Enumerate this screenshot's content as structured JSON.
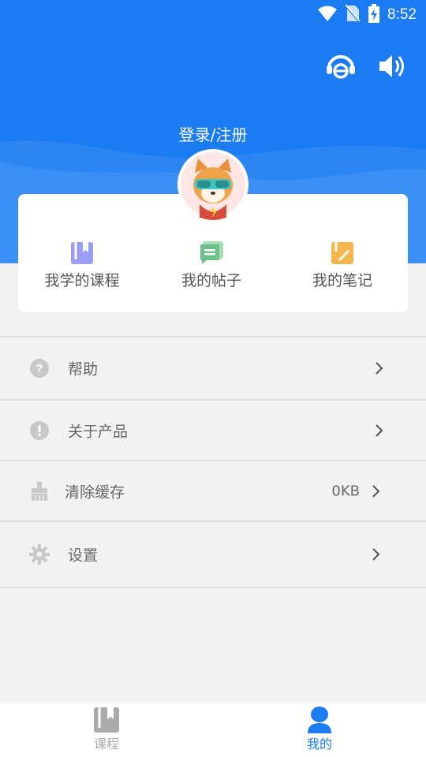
{
  "status_bar": {
    "time": "8:52",
    "icons": [
      "wifi-icon",
      "no-sim-icon",
      "battery-charging-icon"
    ]
  },
  "header": {
    "login_label": "登录/注册",
    "actions": [
      "customer-service-icon",
      "volume-icon"
    ]
  },
  "shortcuts": [
    {
      "label": "我学的课程",
      "icon": "book-icon",
      "color": "#9b9ef7"
    },
    {
      "label": "我的帖子",
      "icon": "message-icon",
      "color": "#6cc08a"
    },
    {
      "label": "我的笔记",
      "icon": "note-icon",
      "color": "#f7b64d"
    }
  ],
  "menu": [
    {
      "label": "帮助",
      "icon": "help-icon",
      "value": ""
    },
    {
      "label": "关于产品",
      "icon": "info-icon",
      "value": ""
    },
    {
      "label": "清除缓存",
      "icon": "broom-icon",
      "value": "0KB"
    },
    {
      "label": "设置",
      "icon": "gear-icon",
      "value": ""
    }
  ],
  "tabbar": {
    "tabs": [
      {
        "label": "课程",
        "icon": "course-tab-icon",
        "active": false
      },
      {
        "label": "我的",
        "icon": "profile-tab-icon",
        "active": true
      }
    ]
  },
  "colors": {
    "brand_blue": "#1a7bf2",
    "active_tab": "#1a7bf2",
    "inactive_tab": "#aaaaaa",
    "menu_icon": "#c8c8c8"
  }
}
